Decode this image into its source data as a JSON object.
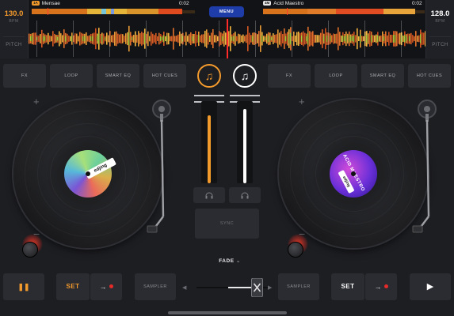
{
  "deck_a": {
    "bpm": "130.0",
    "bpm_unit": "BPM",
    "pitch_label": "PITCH",
    "tag": "1A",
    "track_title": "Mensae",
    "time": "0:02",
    "accent": "#f39a2d",
    "disc_brand": "edjing",
    "fx_buttons": [
      "FX",
      "LOOP",
      "SMART EQ",
      "HOT CUES"
    ],
    "set_label": "SET",
    "sampler_label": "SAMPLER",
    "transport_icon": "pause-icon",
    "transport_glyph": "❚❚",
    "rec_glyph": "→"
  },
  "deck_b": {
    "bpm": "128.0",
    "bpm_unit": "BPM",
    "pitch_label": "PITCH",
    "tag": "4M",
    "track_title": "Acid Maestro",
    "time": "0:02",
    "accent": "#ffffff",
    "disc_title": "ACID MAESTRO",
    "disc_brand": "edjing",
    "fx_buttons": [
      "FX",
      "LOOP",
      "SMART EQ",
      "HOT CUES"
    ],
    "set_label": "SET",
    "sampler_label": "SAMPLER",
    "transport_icon": "play-icon",
    "transport_glyph": "▶",
    "rec_glyph": "→"
  },
  "header": {
    "menu_label": "MENU",
    "menu_color": "#1e3da8"
  },
  "mixer": {
    "cue_glyph": "♫",
    "sync_label": "SYNC",
    "headphone_glyph": "🎧",
    "fader_a_level": 0.83,
    "fader_b_level": 0.9,
    "crossfader_position": 0.85,
    "fade_label": "FADE",
    "fade_chevron": "⌄"
  },
  "deck_controls": {
    "plus_glyph": "+",
    "minus_glyph": "−"
  },
  "xfader_arrows": {
    "left": "◀",
    "right": "▶"
  }
}
